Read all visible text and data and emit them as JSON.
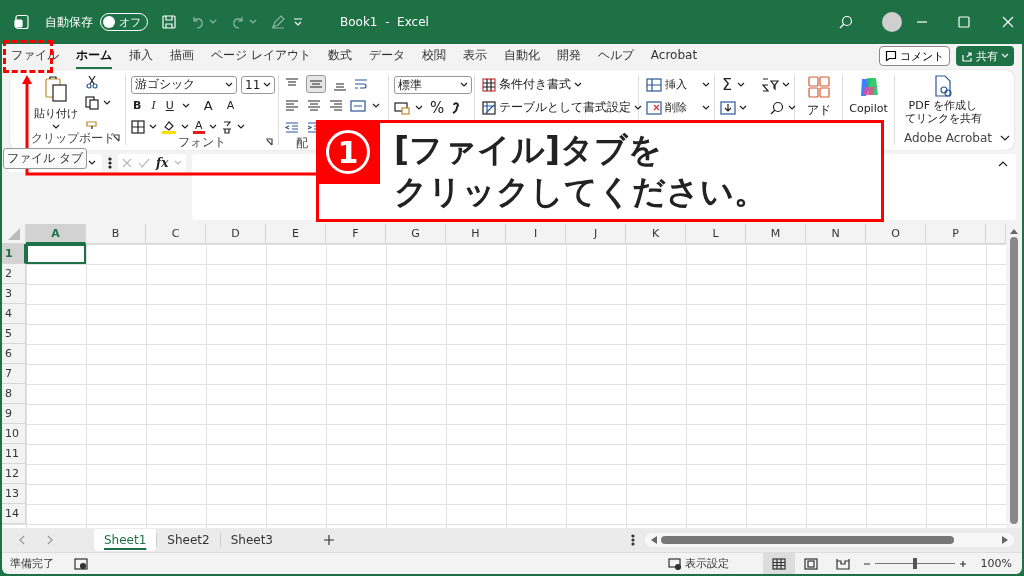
{
  "title_bar": {
    "autosave_label": "自動保存",
    "autosave_toggle": {
      "label": "オフ",
      "on": false
    },
    "document_title": "Book1  -  Excel"
  },
  "ribbon_tabs": [
    {
      "label": "ファイル",
      "selected": false
    },
    {
      "label": "ホーム",
      "selected": true
    },
    {
      "label": "挿入",
      "selected": false
    },
    {
      "label": "描画",
      "selected": false
    },
    {
      "label": "ページ レイアウト",
      "selected": false
    },
    {
      "label": "数式",
      "selected": false
    },
    {
      "label": "データ",
      "selected": false
    },
    {
      "label": "校閲",
      "selected": false
    },
    {
      "label": "表示",
      "selected": false
    },
    {
      "label": "自動化",
      "selected": false
    },
    {
      "label": "開発",
      "selected": false
    },
    {
      "label": "ヘルプ",
      "selected": false
    },
    {
      "label": "Acrobat",
      "selected": false
    }
  ],
  "header_buttons": {
    "comment": "コメント",
    "share": "共有"
  },
  "ribbon": {
    "clipboard": {
      "paste": "貼り付け",
      "group_label": "クリップボード"
    },
    "font": {
      "font_name": "游ゴシック",
      "font_size": "11",
      "bold": "B",
      "italic": "I",
      "underline": "U",
      "grow": "A",
      "shrink": "A",
      "font_color": "A",
      "group_label": "フォント"
    },
    "alignment": {
      "group_label": "配"
    },
    "number": {
      "format": "標準",
      "percent": "%"
    },
    "styles": {
      "conditional_formatting": "条件付き書式",
      "format_as_table": "テーブルとして書式設定"
    },
    "cells": {
      "insert": "挿入",
      "delete": "削除"
    },
    "editing": {
      "sum": "Σ"
    },
    "add_ins": {
      "label": "アド"
    },
    "copilot": {
      "label": "Copilot"
    },
    "adobe": {
      "label_lines": [
        "PDF を作成し",
        "てリンクを共有"
      ],
      "group_label": "Adobe Acrobat"
    }
  },
  "formula_bar": {
    "tooltip": "ファイル タブ",
    "function_label": "fx"
  },
  "callout": {
    "number": "1",
    "lines": [
      "[ファイル]タブを",
      "クリックしてください。"
    ]
  },
  "sheet": {
    "columns": [
      {
        "label": "A",
        "selected": true
      },
      {
        "label": "B",
        "selected": false
      },
      {
        "label": "C",
        "selected": false
      },
      {
        "label": "D",
        "selected": false
      },
      {
        "label": "E",
        "selected": false
      },
      {
        "label": "F",
        "selected": false
      },
      {
        "label": "G",
        "selected": false
      },
      {
        "label": "H",
        "selected": false
      },
      {
        "label": "I",
        "selected": false
      },
      {
        "label": "J",
        "selected": false
      },
      {
        "label": "K",
        "selected": false
      },
      {
        "label": "L",
        "selected": false
      },
      {
        "label": "M",
        "selected": false
      },
      {
        "label": "N",
        "selected": false
      },
      {
        "label": "O",
        "selected": false
      },
      {
        "label": "P",
        "selected": false
      }
    ],
    "rows": [
      {
        "label": "1",
        "selected": true
      },
      {
        "label": "2",
        "selected": false
      },
      {
        "label": "3",
        "selected": false
      },
      {
        "label": "4",
        "selected": false
      },
      {
        "label": "5",
        "selected": false
      },
      {
        "label": "6",
        "selected": false
      },
      {
        "label": "7",
        "selected": false
      },
      {
        "label": "8",
        "selected": false
      },
      {
        "label": "9",
        "selected": false
      },
      {
        "label": "10",
        "selected": false
      },
      {
        "label": "11",
        "selected": false
      },
      {
        "label": "12",
        "selected": false
      },
      {
        "label": "13",
        "selected": false
      },
      {
        "label": "14",
        "selected": false
      }
    ]
  },
  "sheet_tabs": [
    {
      "label": "Sheet1",
      "selected": true
    },
    {
      "label": "Sheet2",
      "selected": false
    },
    {
      "label": "Sheet3",
      "selected": false
    }
  ],
  "status_bar": {
    "status": "準備完了",
    "display_settings": "表示設定",
    "zoom": {
      "level": 0.5
    },
    "zoom_label": "100%"
  }
}
